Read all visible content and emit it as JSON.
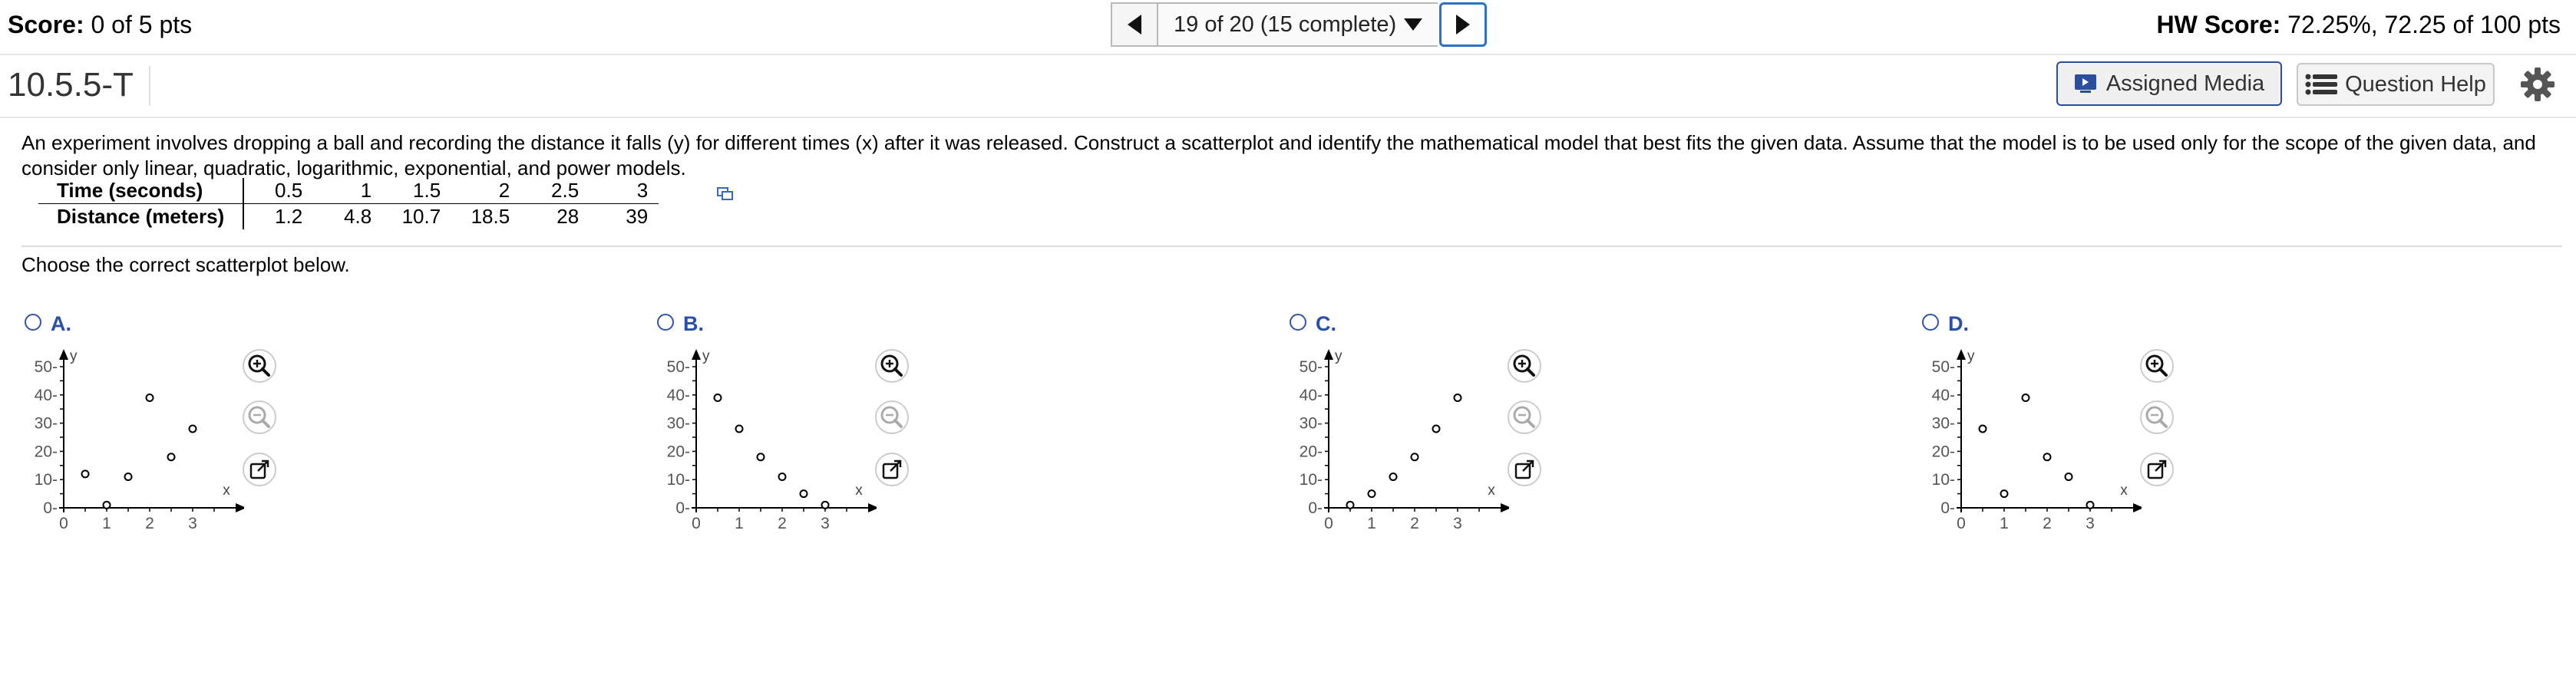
{
  "header": {
    "score_label": "Score:",
    "score_value": " 0 of 5 pts",
    "nav_text": "19 of 20 (15 complete)",
    "hw_label": "HW Score:",
    "hw_value": " 72.25%, 72.25 of 100 pts"
  },
  "question": {
    "id": "10.5.5-T",
    "assigned_media": "Assigned Media",
    "question_help": "Question Help",
    "text": "An experiment involves dropping a ball and recording the distance it falls (y) for different times  (x) after it was released. Construct a scatterplot and identify the mathematical model that best fits the given data. Assume that the model is to be used only for the scope of the given data, and consider only linear, quadratic, logarithmic, exponential, and power models.",
    "table": {
      "row1_label": "Time (seconds)",
      "row2_label": "Distance (meters)",
      "times": [
        "0.5",
        "1",
        "1.5",
        "2",
        "2.5",
        "3"
      ],
      "distances": [
        "1.2",
        "4.8",
        "10.7",
        "18.5",
        "28",
        "39"
      ]
    },
    "prompt": "Choose the correct scatterplot below."
  },
  "options": [
    {
      "label": "A.",
      "points": [
        [
          0.5,
          12
        ],
        [
          1,
          1
        ],
        [
          1.5,
          11
        ],
        [
          2,
          39
        ],
        [
          2.5,
          18
        ],
        [
          3,
          28
        ]
      ]
    },
    {
      "label": "B.",
      "points": [
        [
          0.5,
          39
        ],
        [
          1,
          28
        ],
        [
          1.5,
          18
        ],
        [
          2,
          11
        ],
        [
          2.5,
          5
        ],
        [
          3,
          1
        ]
      ]
    },
    {
      "label": "C.",
      "points": [
        [
          0.5,
          1
        ],
        [
          1,
          5
        ],
        [
          1.5,
          11
        ],
        [
          2,
          18
        ],
        [
          2.5,
          28
        ],
        [
          3,
          39
        ]
      ]
    },
    {
      "label": "D.",
      "points": [
        [
          0.5,
          28
        ],
        [
          1,
          5
        ],
        [
          1.5,
          39
        ],
        [
          2,
          18
        ],
        [
          2.5,
          11
        ],
        [
          3,
          1
        ]
      ]
    }
  ],
  "plot_axes": {
    "y_ticks": [
      "50",
      "40",
      "30",
      "20",
      "10",
      "0"
    ],
    "x_ticks": [
      "0",
      "1",
      "2",
      "3"
    ],
    "xlabel": "x",
    "ylabel": "y",
    "xlim": [
      0,
      4
    ],
    "ylim": [
      0,
      55
    ]
  }
}
